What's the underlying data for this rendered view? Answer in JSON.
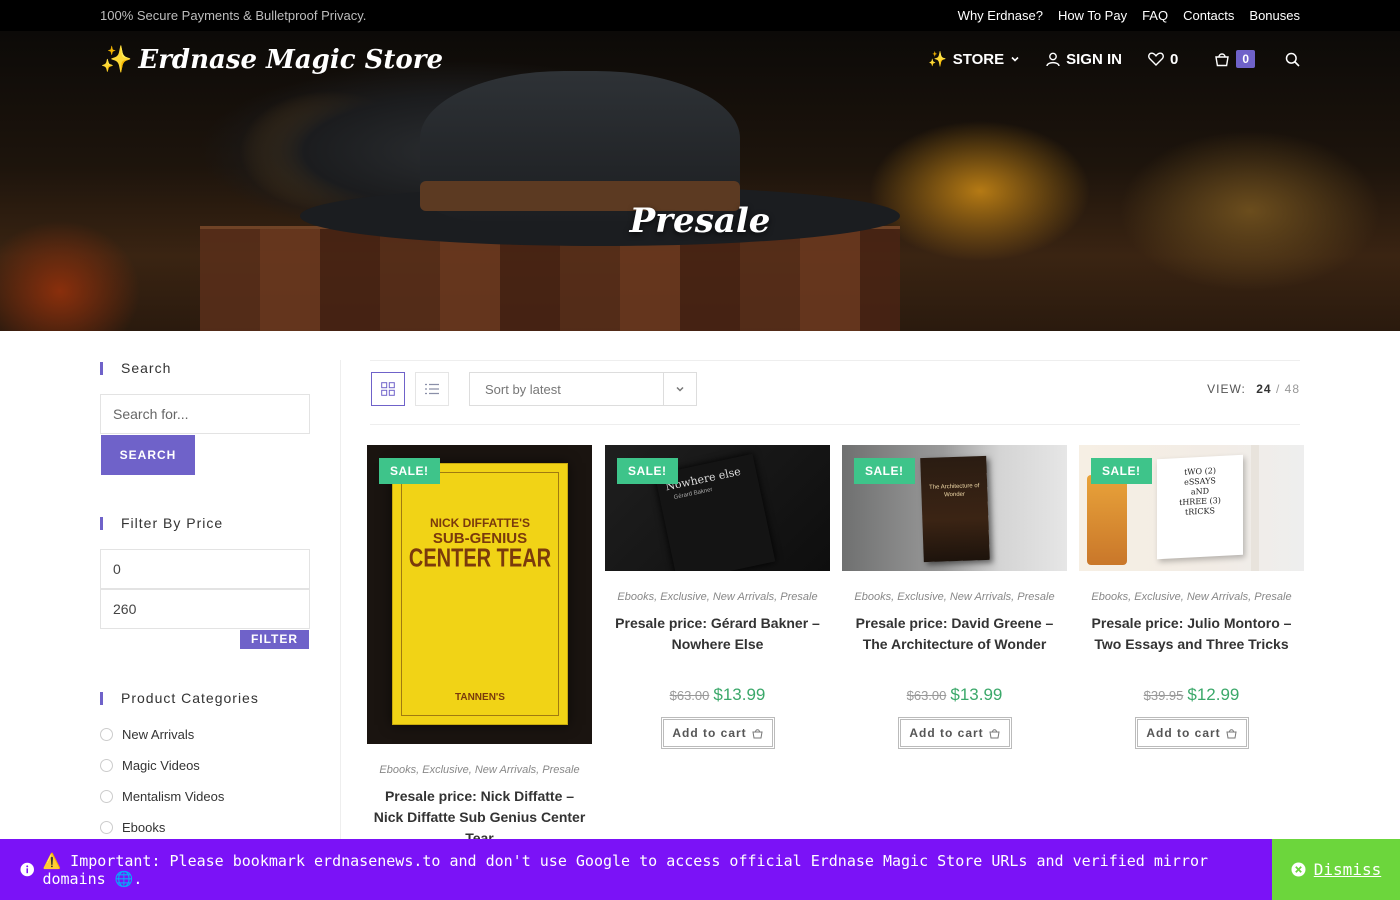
{
  "topbar": {
    "secure_text": "100% Secure Payments & Bulletproof Privacy.",
    "links": [
      "Why Erdnase?",
      "How To Pay",
      "FAQ",
      "Contacts",
      "Bonuses"
    ]
  },
  "header": {
    "logo_spark": "✨",
    "logo_text": "Erdnase Magic Store",
    "nav": {
      "store_label": "STORE",
      "signin_label": "SIGN IN",
      "wishlist_count": "0",
      "cart_count": "0"
    }
  },
  "hero": {
    "title": "Presale"
  },
  "sidebar": {
    "search_title": "Search",
    "search_placeholder": "Search for...",
    "search_button": "SEARCH",
    "price_title": "Filter By Price",
    "price_min": "0",
    "price_max": "260",
    "filter_button": "FILTER",
    "categories_title": "Product Categories",
    "categories": [
      "New Arrivals",
      "Magic Videos",
      "Mentalism Videos",
      "Ebooks"
    ]
  },
  "toolbar": {
    "sort_label": "Sort by latest",
    "view_label": "VIEW:",
    "view_24": "24",
    "view_slash": "/",
    "view_48": "48"
  },
  "products": [
    {
      "sale": "SALE!",
      "categories": [
        "Ebooks",
        "Exclusive",
        "New Arrivals",
        "Presale"
      ],
      "title": "Presale price: Nick Diffatte – Nick Diffatte Sub Genius Center Tear",
      "cover_lines": [
        "NICK DIFFATTE'S",
        "SUB-GENIUS",
        "CENTER TEAR",
        "TANNEN'S"
      ]
    },
    {
      "sale": "SALE!",
      "categories": [
        "Ebooks",
        "Exclusive",
        "New Arrivals",
        "Presale"
      ],
      "title": "Presale price: Gérard Bakner – Nowhere Else",
      "old_price": "$63.00",
      "new_price": "$13.99",
      "add_to_cart": "Add to cart",
      "cover_lines": [
        "Nowhere else",
        "Gérard Bakner"
      ]
    },
    {
      "sale": "SALE!",
      "categories": [
        "Ebooks",
        "Exclusive",
        "New Arrivals",
        "Presale"
      ],
      "title": "Presale price: David Greene – The Architecture of Wonder",
      "old_price": "$63.00",
      "new_price": "$13.99",
      "add_to_cart": "Add to cart",
      "cover_lines": [
        "The Architecture of Wonder"
      ]
    },
    {
      "sale": "SALE!",
      "categories": [
        "Ebooks",
        "Exclusive",
        "New Arrivals",
        "Presale"
      ],
      "title": "Presale price: Julio Montoro – Two Essays and Three Tricks",
      "old_price": "$39.95",
      "new_price": "$12.99",
      "add_to_cart": "Add to cart",
      "cover_lines": [
        "tWO (2)",
        "eSSAYS",
        "aND",
        "tHREE (3)",
        "tRICKS"
      ]
    }
  ],
  "notice": {
    "text": "⚠️ Important: Please bookmark erdnasenews.to and don't use Google to access official Erdnase Magic Store URLs and verified mirror domains 🌐.",
    "dismiss": "Dismiss"
  },
  "colors": {
    "accent": "#6f62c9",
    "sale_badge": "#3ec48a",
    "price_new": "#3ba86a",
    "notice_bg": "#7b12f7",
    "dismiss_bg": "#6cd63c"
  }
}
